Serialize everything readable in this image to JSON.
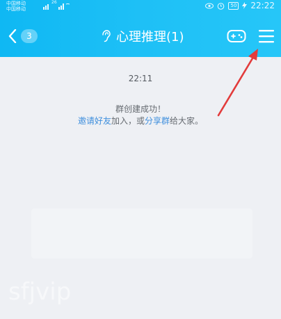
{
  "status_bar": {
    "carrier_1": "中国移动",
    "carrier_2": "中国移动",
    "signal_label": "26",
    "battery": "50",
    "time": "22:22"
  },
  "nav": {
    "unread_count": "3",
    "title": "心理推理(1)"
  },
  "chat": {
    "timestamp": "22:11",
    "system_message": {
      "line1": "群创建成功！",
      "invite_link": "邀请好友",
      "middle_text": "加入，或",
      "share_link": "分享群",
      "end_text": "给大家。"
    }
  },
  "watermark": "sfjvip",
  "colors": {
    "header": "#1ec0f6",
    "background": "#eef0f4",
    "link": "#3f8fdd",
    "annotation_arrow": "#e23b3b"
  },
  "icons": [
    "back-chevron-icon",
    "ear-icon",
    "game-controller-icon",
    "menu-icon",
    "wifi-icon",
    "alarm-icon",
    "eye-icon"
  ]
}
